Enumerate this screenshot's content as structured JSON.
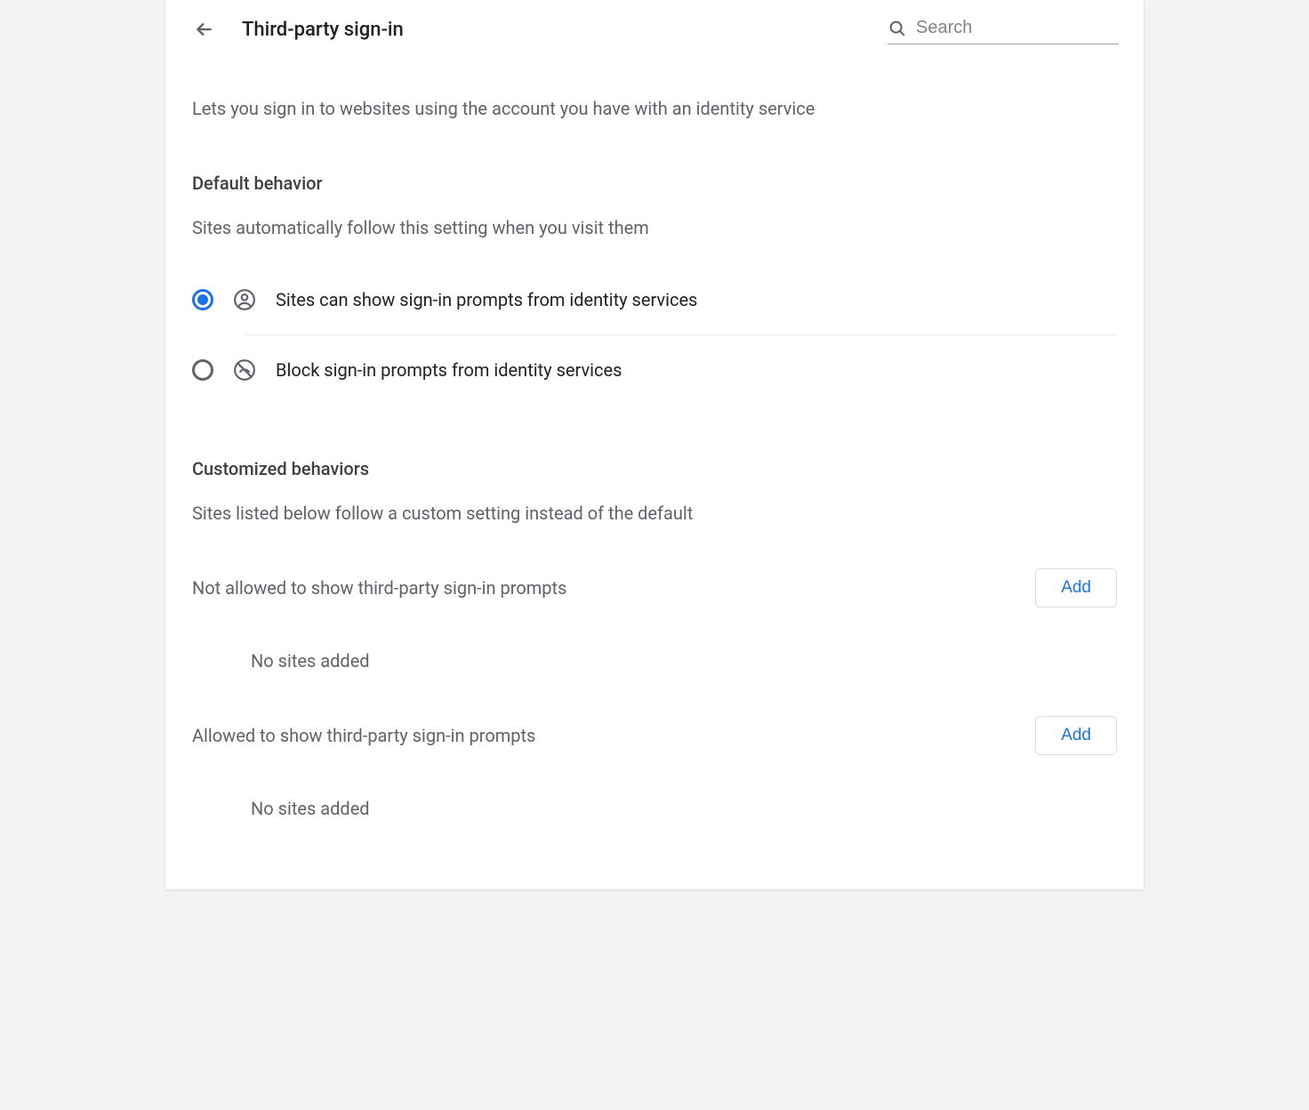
{
  "header": {
    "title": "Third-party sign-in",
    "search_placeholder": "Search"
  },
  "description": "Lets you sign in to websites using the account you have with an identity service",
  "default_behavior": {
    "title": "Default behavior",
    "subtitle": "Sites automatically follow this setting when you visit them",
    "options": [
      {
        "label": "Sites can show sign-in prompts from identity services",
        "selected": true
      },
      {
        "label": "Block sign-in prompts from identity services",
        "selected": false
      }
    ]
  },
  "customized": {
    "title": "Customized behaviors",
    "subtitle": "Sites listed below follow a custom setting instead of the default",
    "not_allowed": {
      "label": "Not allowed to show third-party sign-in prompts",
      "add_label": "Add",
      "empty": "No sites added"
    },
    "allowed": {
      "label": "Allowed to show third-party sign-in prompts",
      "add_label": "Add",
      "empty": "No sites added"
    }
  }
}
